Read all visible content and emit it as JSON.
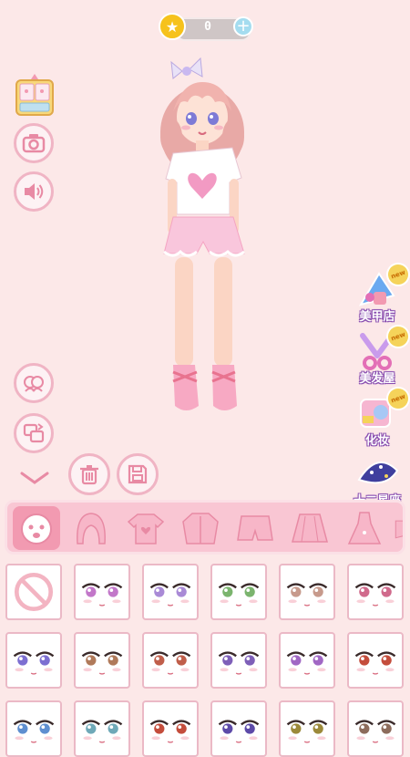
{
  "coins": {
    "value": "0"
  },
  "left_buttons": [
    {
      "name": "wardrobe-button",
      "icon": "wardrobe-icon"
    },
    {
      "name": "camera-button",
      "icon": "camera-icon"
    },
    {
      "name": "sound-button",
      "icon": "speaker-icon"
    },
    {
      "name": "friends-button",
      "icon": "faces-icon"
    },
    {
      "name": "swap-button",
      "icon": "swap-icon"
    }
  ],
  "bottom_buttons": [
    {
      "name": "collapse-arrow",
      "icon": "chevron-down-icon"
    },
    {
      "name": "delete-button",
      "icon": "trash-icon"
    },
    {
      "name": "save-button",
      "icon": "save-icon"
    }
  ],
  "features": [
    {
      "label": "美甲店",
      "badge": "new",
      "icon": "nail-salon-icon"
    },
    {
      "label": "美发屋",
      "badge": "new",
      "icon": "hair-salon-icon"
    },
    {
      "label": "化妆",
      "badge": "new",
      "icon": "makeup-icon"
    },
    {
      "label": "十二星座",
      "badge": "",
      "icon": "zodiac-icon"
    }
  ],
  "categories": [
    "face",
    "hair",
    "tshirt",
    "jacket",
    "shorts",
    "skirt",
    "dress",
    "shoes"
  ],
  "selected_category": "face",
  "grid": {
    "rows": [
      [
        "none",
        "#c277c9",
        "#a98ad6",
        "#7bb46e",
        "#c79a8c",
        "#d06a8c"
      ],
      [
        "#7d6fd1",
        "#b07a5a",
        "#c05e4a",
        "#7e5fb8",
        "#a167c4",
        "#c44d3c"
      ],
      [
        "#5f8fd0",
        "#6fa9b8",
        "#c44d3c",
        "#5d4aa8",
        "#9c8a3a",
        "#8d6c5c"
      ]
    ]
  },
  "colors": {
    "background": "#fce8e8",
    "accent": "#f0b4c4",
    "category_bg": "#f9c6d3",
    "selected": "#f29ab1"
  }
}
